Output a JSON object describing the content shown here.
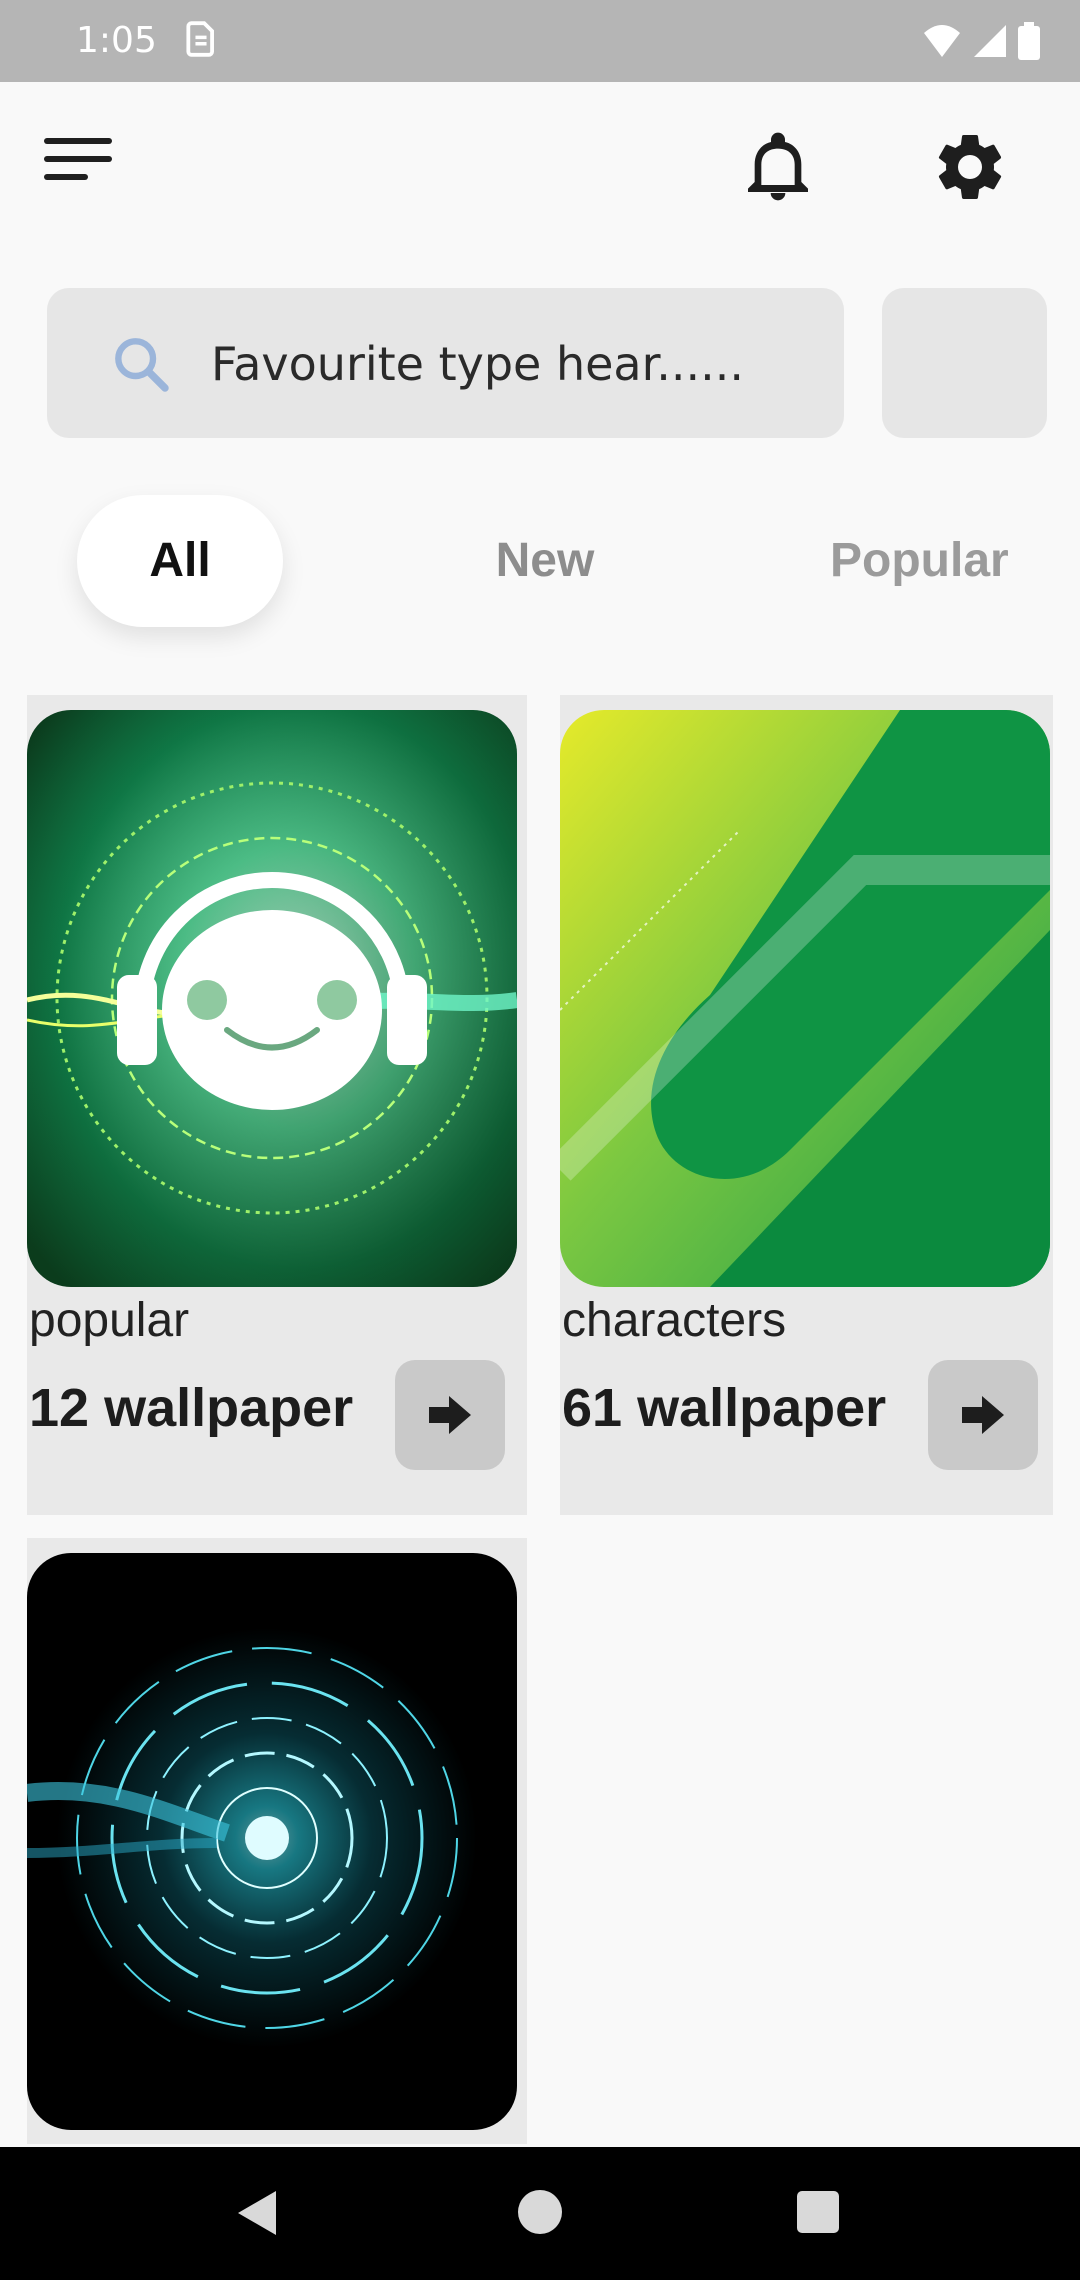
{
  "status_bar": {
    "time": "1:05",
    "icons": [
      "sim-icon",
      "wifi-icon",
      "cellular-signal-icon",
      "battery-icon"
    ]
  },
  "app_bar": {
    "menu_icon": "menu-icon",
    "notification_icon": "bell-icon",
    "settings_icon": "gear-icon"
  },
  "search": {
    "placeholder": "Favourite type hear......",
    "icon": "search-icon"
  },
  "tabs": [
    {
      "label": "All",
      "active": true
    },
    {
      "label": "New",
      "active": false
    },
    {
      "label": "Popular",
      "active": false
    }
  ],
  "categories": [
    {
      "label": "popular",
      "count": "12 wallpaper",
      "image": "robot-headphones-wallpaper"
    },
    {
      "label": "characters",
      "count": "61 wallpaper",
      "image": "green-abstract-wallpaper"
    },
    {
      "label": "",
      "count": "",
      "image": "cyan-circuit-rings-wallpaper"
    }
  ],
  "colors": {
    "status_bar": "#b5b5b5",
    "background": "#f9f9f9",
    "search_bg": "#e6e6e6",
    "card_bg": "#e9e9e9",
    "tab_inactive": "#8d8d8d",
    "arrow_button": "#c9c9c9",
    "nav_bar": "#000000"
  }
}
